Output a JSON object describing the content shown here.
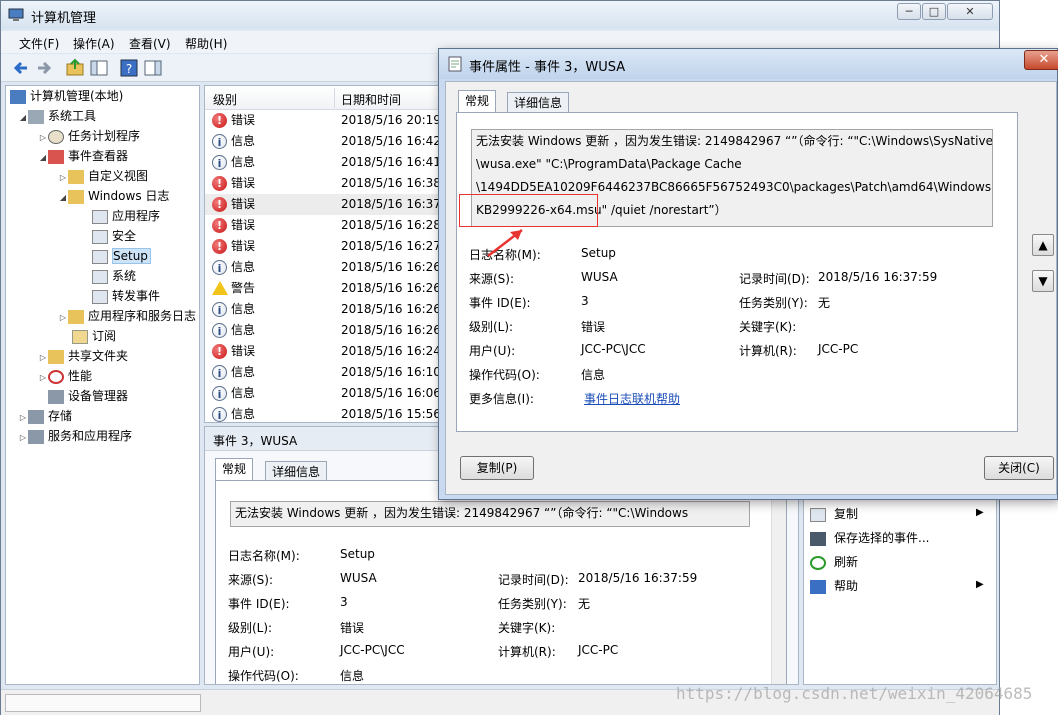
{
  "window": {
    "title": "计算机管理",
    "caption": {
      "minimize": "─",
      "maximize": "□",
      "close": "✕"
    }
  },
  "menu": [
    "文件(F)",
    "操作(A)",
    "查看(V)",
    "帮助(H)"
  ],
  "tree": {
    "root": "计算机管理(本地)",
    "system_tools": "系统工具",
    "task_scheduler": "任务计划程序",
    "event_viewer": "事件查看器",
    "custom_views": "自定义视图",
    "windows_logs": "Windows 日志",
    "application": "应用程序",
    "security": "安全",
    "setup": "Setup",
    "system": "系统",
    "forwarded": "转发事件",
    "app_service_logs": "应用程序和服务日志",
    "subscriptions": "订阅",
    "shared_folders": "共享文件夹",
    "performance": "性能",
    "device_manager": "设备管理器",
    "storage": "存储",
    "services_apps": "服务和应用程序"
  },
  "list": {
    "col_level": "级别",
    "col_datetime": "日期和时间",
    "rows": [
      {
        "level": "错误",
        "type": "error",
        "date": "2018/5/16 20:19:"
      },
      {
        "level": "信息",
        "type": "info",
        "date": "2018/5/16 16:42:"
      },
      {
        "level": "信息",
        "type": "info",
        "date": "2018/5/16 16:41:"
      },
      {
        "level": "错误",
        "type": "error",
        "date": "2018/5/16 16:38:"
      },
      {
        "level": "错误",
        "type": "error",
        "date": "2018/5/16 16:37:"
      },
      {
        "level": "错误",
        "type": "error",
        "date": "2018/5/16 16:28:"
      },
      {
        "level": "错误",
        "type": "error",
        "date": "2018/5/16 16:27:"
      },
      {
        "level": "信息",
        "type": "info",
        "date": "2018/5/16 16:26:"
      },
      {
        "level": "警告",
        "type": "warn",
        "date": "2018/5/16 16:26:"
      },
      {
        "level": "信息",
        "type": "info",
        "date": "2018/5/16 16:26:"
      },
      {
        "level": "信息",
        "type": "info",
        "date": "2018/5/16 16:26:"
      },
      {
        "level": "错误",
        "type": "error",
        "date": "2018/5/16 16:24:"
      },
      {
        "level": "信息",
        "type": "info",
        "date": "2018/5/16 16:10:"
      },
      {
        "level": "信息",
        "type": "info",
        "date": "2018/5/16 16:06:"
      },
      {
        "level": "信息",
        "type": "info",
        "date": "2018/5/16 15:56:"
      }
    ]
  },
  "detail": {
    "header": "事件 3，WUSA",
    "tab_general": "常规",
    "tab_details": "详细信息",
    "message": "无法安装 Windows 更新 ，因为发生错误: 2149842967 “”（命令行: “\"C:\\Windows",
    "log_name_label": "日志名称(M):",
    "log_name": "Setup",
    "source_label": "来源(S):",
    "source": "WUSA",
    "logged_label": "记录时间(D):",
    "logged": "2018/5/16 16:37:59",
    "event_id_label": "事件 ID(E):",
    "event_id": "3",
    "task_label": "任务类别(Y):",
    "task": "无",
    "level_label": "级别(L):",
    "level": "错误",
    "keywords_label": "关键字(K):",
    "user_label": "用户(U):",
    "user": "JCC-PC\\JCC",
    "computer_label": "计算机(R):",
    "computer": "JCC-PC",
    "opcode_label": "操作代码(O):",
    "opcode": "信息"
  },
  "actions": {
    "copy": "复制",
    "save_selected": "保存选择的事件...",
    "refresh": "刷新",
    "help": "帮助"
  },
  "dialog": {
    "title": "事件属性 - 事件 3，WUSA",
    "tab_general": "常规",
    "tab_details": "详细信息",
    "message_lines": [
      "无法安装 Windows 更新 ，因为发生错误: 2149842967 “”（命令行: “\"C:\\Windows\\SysNative",
      "\\wusa.exe\" \"C:\\ProgramData\\Package Cache",
      "\\1494DD5EA10209F6446237BC86665F56752493C0\\packages\\Patch\\amd64\\Windows6.1-",
      "KB2999226-x64.msu\" /quiet /norestart”）"
    ],
    "log_name_label": "日志名称(M):",
    "log_name": "Setup",
    "source_label": "来源(S):",
    "source": "WUSA",
    "logged_label": "记录时间(D):",
    "logged": "2018/5/16 16:37:59",
    "event_id_label": "事件 ID(E):",
    "event_id": "3",
    "task_label": "任务类别(Y):",
    "task": "无",
    "level_label": "级别(L):",
    "level": "错误",
    "keywords_label": "关键字(K):",
    "user_label": "用户(U):",
    "user": "JCC-PC\\JCC",
    "computer_label": "计算机(R):",
    "computer": "JCC-PC",
    "opcode_label": "操作代码(O):",
    "opcode": "信息",
    "more_info_label": "更多信息(I):",
    "more_info_link": "事件日志联机帮助",
    "copy_button": "复制(P)",
    "close_button": "关闭(C)"
  },
  "watermark": "https://blog.csdn.net/weixin_42064685",
  "colors": {
    "error": "#c81414",
    "highlight": "#e8332e",
    "link": "#1a4db8"
  }
}
